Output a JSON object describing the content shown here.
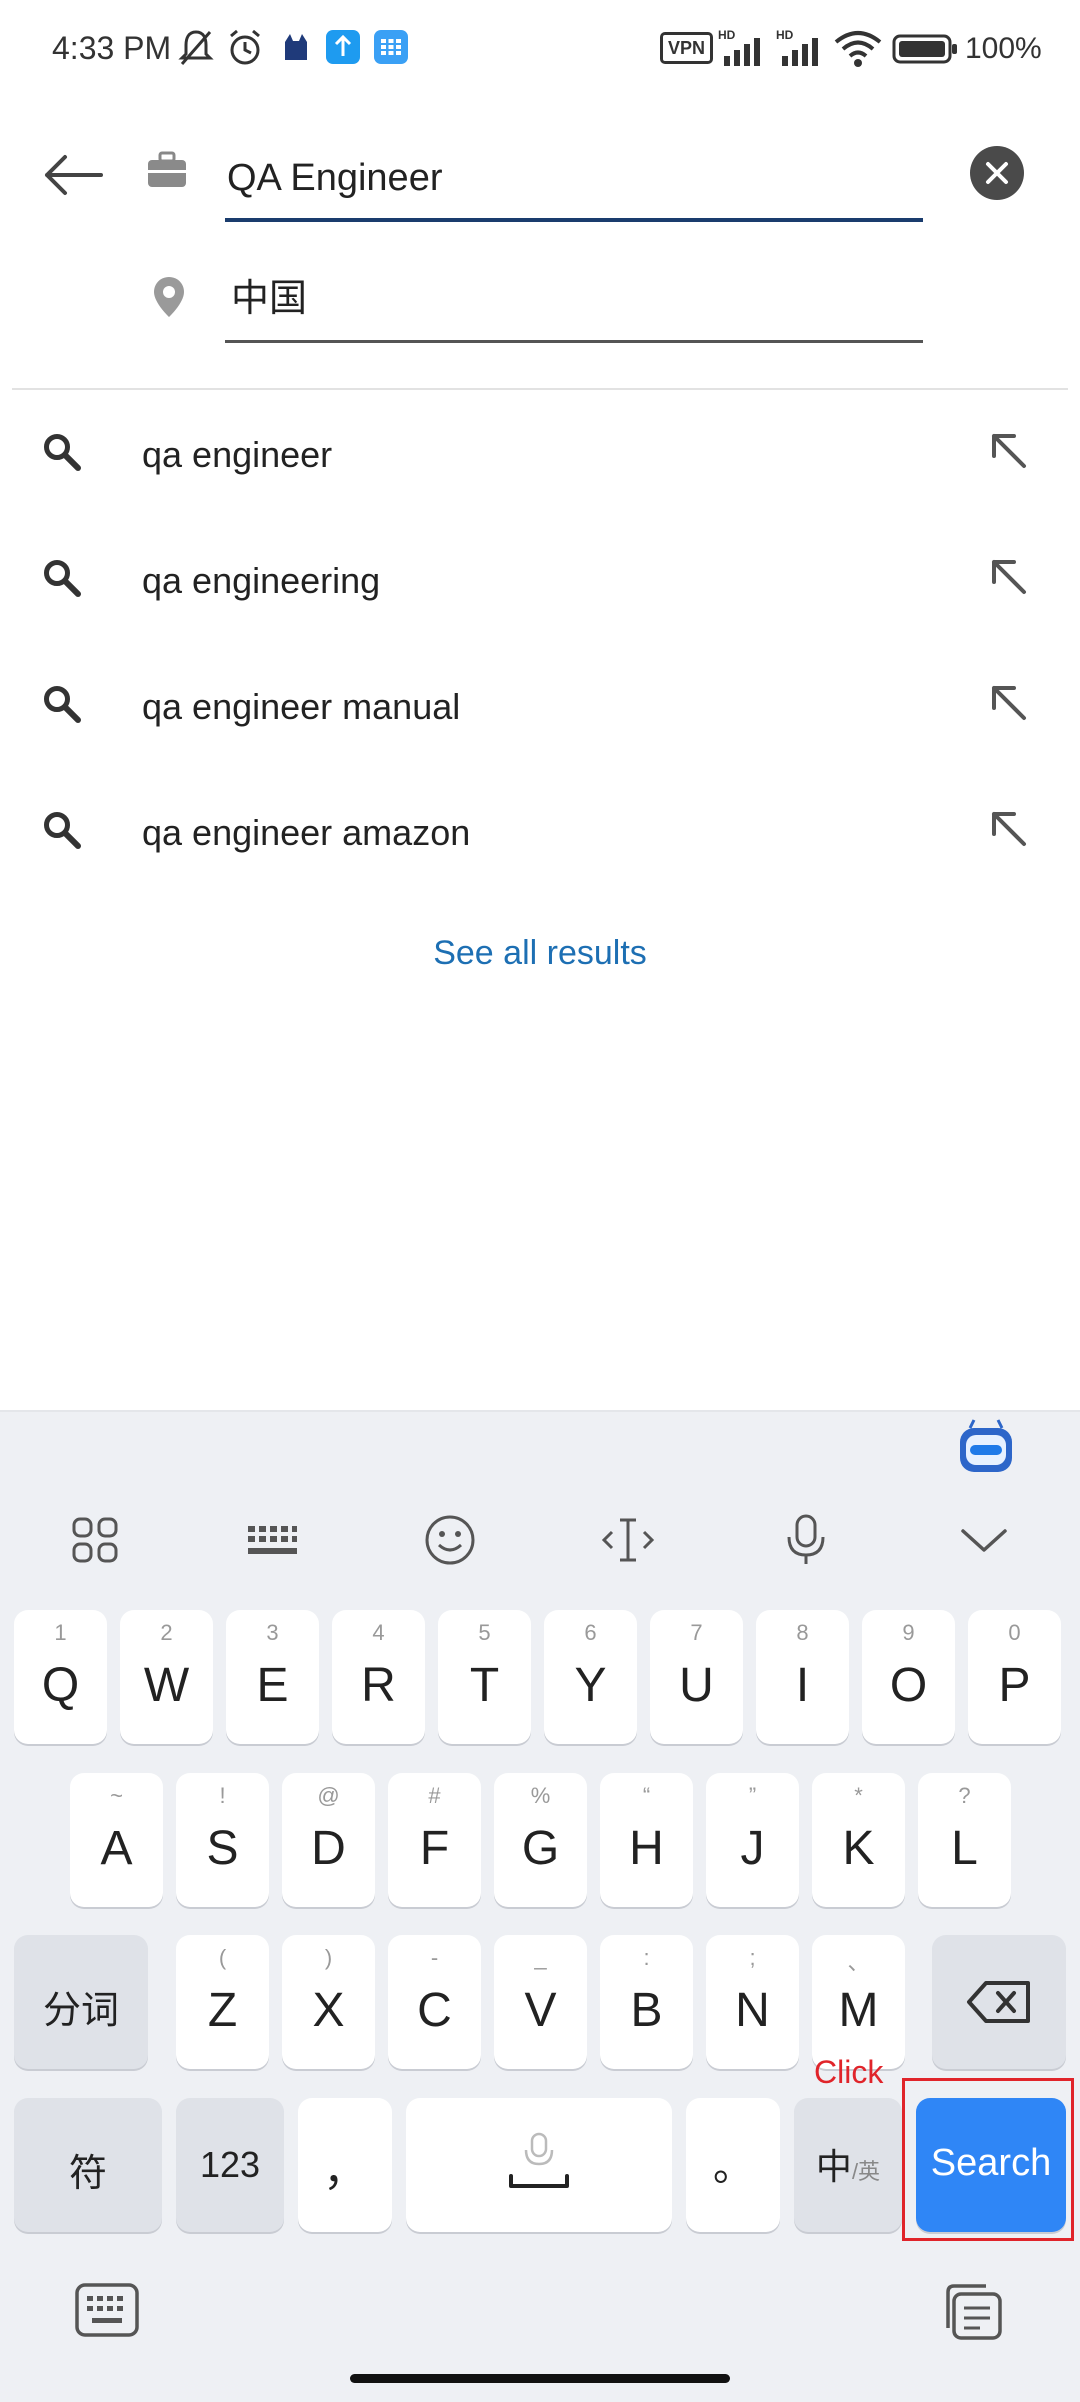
{
  "status_bar": {
    "time": "4:33 PM",
    "battery": "100%",
    "vpn": "VPN",
    "network_label": "HD",
    "icons": [
      "mute-bell-icon",
      "alarm-icon",
      "app-cat-icon",
      "upload-icon",
      "grid-app-icon",
      "vpn-icon",
      "signal-icon",
      "wifi-icon",
      "battery-icon"
    ]
  },
  "search": {
    "job_query": "QA Engineer",
    "location": "中国"
  },
  "suggestions": [
    {
      "label": "qa engineer"
    },
    {
      "label": "qa engineering"
    },
    {
      "label": "qa engineer manual"
    },
    {
      "label": "qa engineer amazon"
    }
  ],
  "see_all": "See all results",
  "keyboard": {
    "row1": [
      {
        "sub": "1",
        "main": "Q"
      },
      {
        "sub": "2",
        "main": "W"
      },
      {
        "sub": "3",
        "main": "E"
      },
      {
        "sub": "4",
        "main": "R"
      },
      {
        "sub": "5",
        "main": "T"
      },
      {
        "sub": "6",
        "main": "Y"
      },
      {
        "sub": "7",
        "main": "U"
      },
      {
        "sub": "8",
        "main": "I"
      },
      {
        "sub": "9",
        "main": "O"
      },
      {
        "sub": "0",
        "main": "P"
      }
    ],
    "row2": [
      {
        "sub": "~",
        "main": "A"
      },
      {
        "sub": "!",
        "main": "S"
      },
      {
        "sub": "@",
        "main": "D"
      },
      {
        "sub": "#",
        "main": "F"
      },
      {
        "sub": "%",
        "main": "G"
      },
      {
        "sub": "“",
        "main": "H"
      },
      {
        "sub": "”",
        "main": "J"
      },
      {
        "sub": "*",
        "main": "K"
      },
      {
        "sub": "?",
        "main": "L"
      }
    ],
    "row3": [
      {
        "sub": "(",
        "main": "Z"
      },
      {
        "sub": ")",
        "main": "X"
      },
      {
        "sub": "-",
        "main": "C"
      },
      {
        "sub": "_",
        "main": "V"
      },
      {
        "sub": ":",
        "main": "B"
      },
      {
        "sub": ";",
        "main": "N"
      },
      {
        "sub": "、",
        "main": "M"
      }
    ],
    "fenci": "分词",
    "fu": "符",
    "num": "123",
    "comma": "，",
    "period": "。",
    "zh": "中",
    "en": "/英",
    "search": "Search"
  },
  "annotation": {
    "click_label": "Click",
    "color": "#e0242a"
  },
  "colors": {
    "accent_blue": "#2f86f6",
    "link_blue": "#1d6fb3",
    "field_underline": "#1a3c6d"
  }
}
